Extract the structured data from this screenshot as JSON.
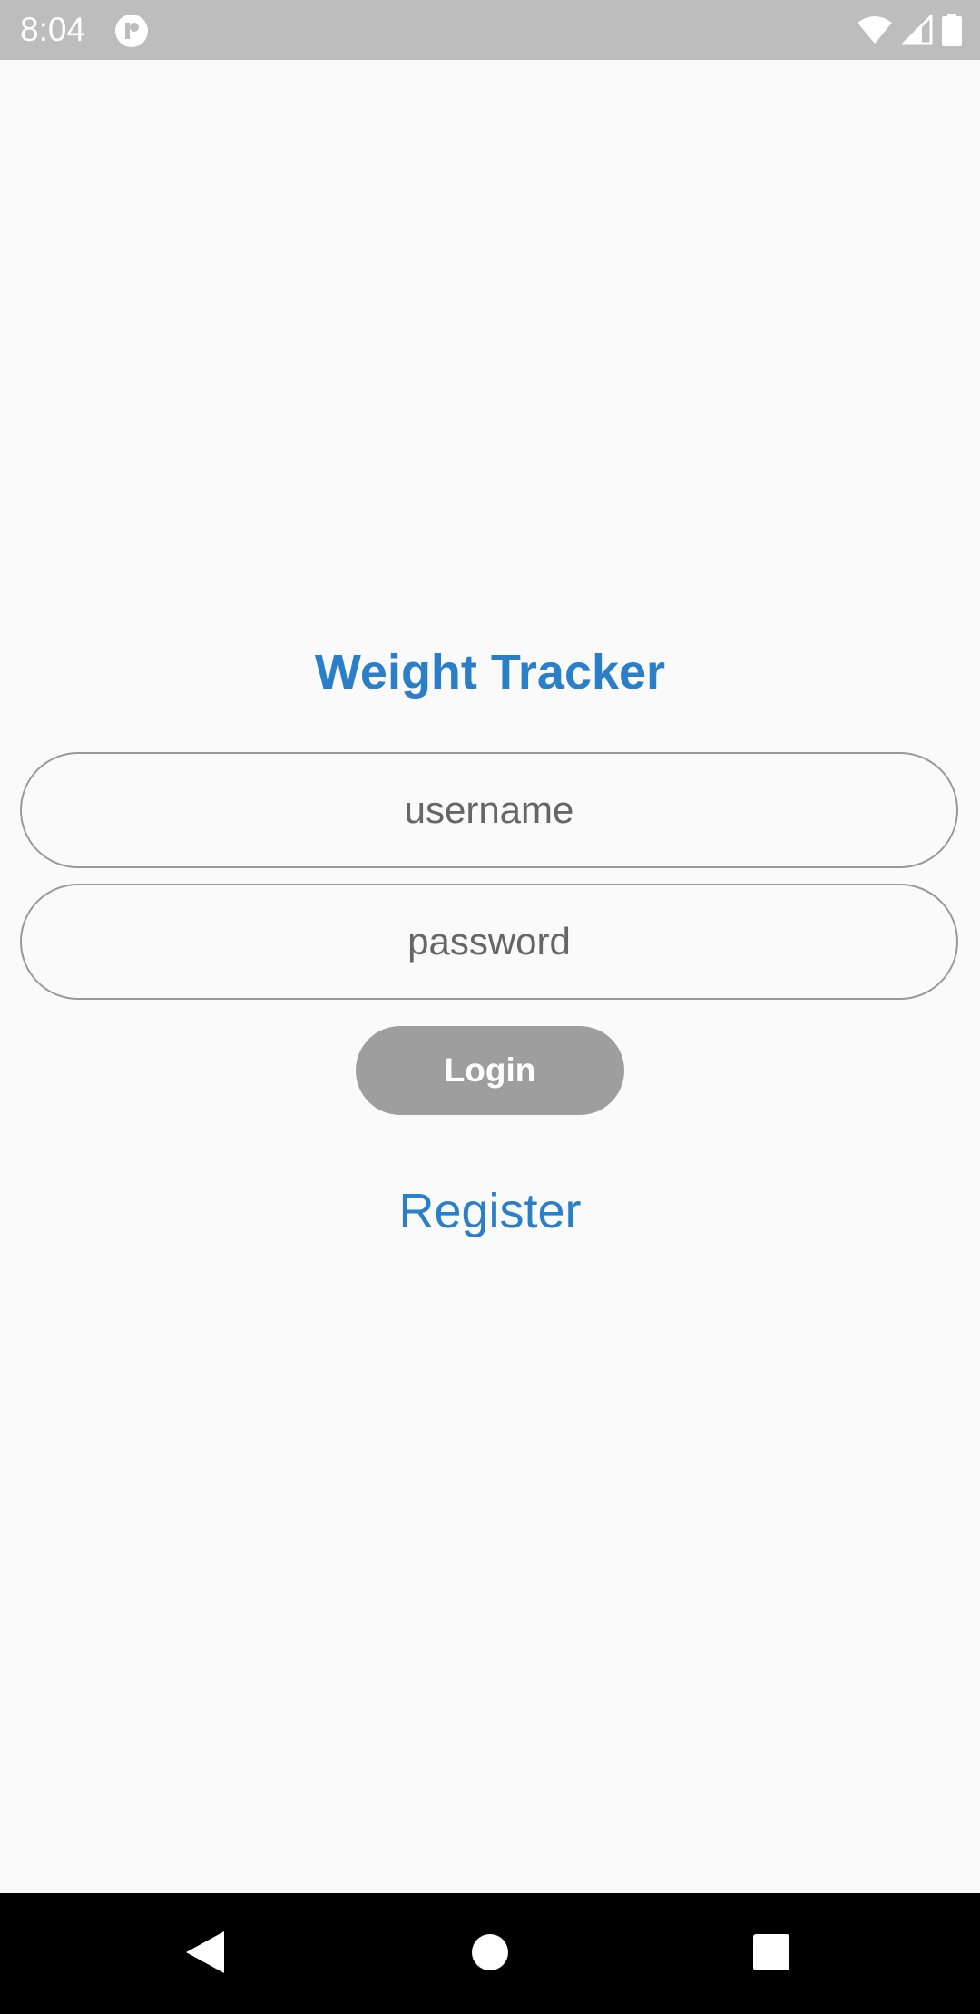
{
  "status_bar": {
    "time": "8:04",
    "icons": [
      "app-notification-icon",
      "wifi-icon",
      "cell-signal-icon",
      "battery-icon"
    ]
  },
  "app": {
    "title": "Weight Tracker",
    "accent_color": "#2a7fc8"
  },
  "form": {
    "username_placeholder": "username",
    "username_value": "",
    "password_placeholder": "password",
    "password_value": "",
    "login_label": "Login",
    "register_label": "Register"
  },
  "nav_bar": {
    "buttons": [
      "back-icon",
      "home-icon",
      "recents-icon"
    ]
  }
}
